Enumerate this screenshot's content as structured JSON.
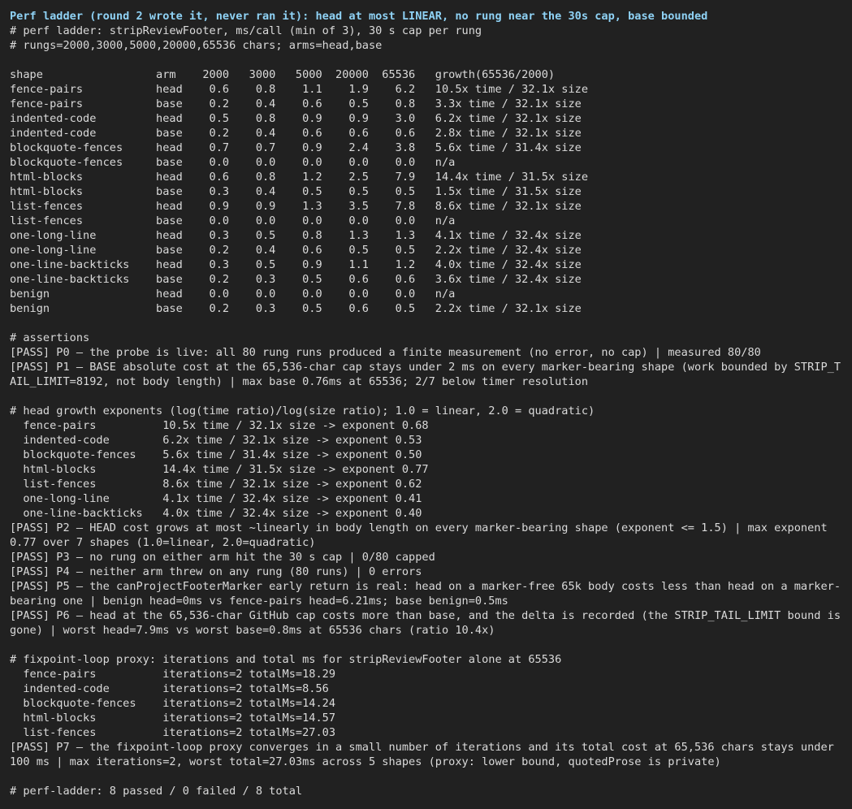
{
  "terminal": {
    "title": "Perf ladder (round 2 wrote it, never ran it): head at most LINEAR, no rung near the 30s cap, base bounded",
    "header": [
      "# perf ladder: stripReviewFooter, ms/call (min of 3), 30 s cap per rung",
      "# rungs=2000,3000,5000,20000,65536 chars; arms=head,base"
    ],
    "table_header": "shape                 arm    2000   3000   5000  20000  65536   growth(65536/2000)",
    "table_rows": [
      "fence-pairs           head    0.6    0.8    1.1    1.9    6.2   10.5x time / 32.1x size",
      "fence-pairs           base    0.2    0.4    0.6    0.5    0.8   3.3x time / 32.1x size",
      "indented-code         head    0.5    0.8    0.9    0.9    3.0   6.2x time / 32.1x size",
      "indented-code         base    0.2    0.4    0.6    0.6    0.6   2.8x time / 32.1x size",
      "blockquote-fences     head    0.7    0.7    0.9    2.4    3.8   5.6x time / 31.4x size",
      "blockquote-fences     base    0.0    0.0    0.0    0.0    0.0   n/a",
      "html-blocks           head    0.6    0.8    1.2    2.5    7.9   14.4x time / 31.5x size",
      "html-blocks           base    0.3    0.4    0.5    0.5    0.5   1.5x time / 31.5x size",
      "list-fences           head    0.9    0.9    1.3    3.5    7.8   8.6x time / 32.1x size",
      "list-fences           base    0.0    0.0    0.0    0.0    0.0   n/a",
      "one-long-line         head    0.3    0.5    0.8    1.3    1.3   4.1x time / 32.4x size",
      "one-long-line         base    0.2    0.4    0.6    0.5    0.5   2.2x time / 32.4x size",
      "one-line-backticks    head    0.3    0.5    0.9    1.1    1.2   4.0x time / 32.4x size",
      "one-line-backticks    base    0.2    0.3    0.5    0.6    0.6   3.6x time / 32.4x size",
      "benign                head    0.0    0.0    0.0    0.0    0.0   n/a",
      "benign                base    0.2    0.3    0.5    0.6    0.5   2.2x time / 32.1x size"
    ],
    "assertions_header": "# assertions",
    "p0": "[PASS] P0 — the probe is live: all 80 rung runs produced a finite measurement (no error, no cap) | measured 80/80",
    "p1": "[PASS] P1 — BASE absolute cost at the 65,536-char cap stays under 2 ms on every marker-bearing shape (work bounded by STRIP_TAIL_LIMIT=8192, not body length) | max base 0.76ms at 65536; 2/7 below timer resolution",
    "growth_header": "# head growth exponents (log(time ratio)/log(size ratio); 1.0 = linear, 2.0 = quadratic)",
    "growth_rows": [
      "  fence-pairs          10.5x time / 32.1x size -> exponent 0.68",
      "  indented-code        6.2x time / 32.1x size -> exponent 0.53",
      "  blockquote-fences    5.6x time / 31.4x size -> exponent 0.50",
      "  html-blocks          14.4x time / 31.5x size -> exponent 0.77",
      "  list-fences          8.6x time / 32.1x size -> exponent 0.62",
      "  one-long-line        4.1x time / 32.4x size -> exponent 0.41",
      "  one-line-backticks   4.0x time / 32.4x size -> exponent 0.40"
    ],
    "p2": "[PASS] P2 — HEAD cost grows at most ~linearly in body length on every marker-bearing shape (exponent <= 1.5) | max exponent 0.77 over 7 shapes (1.0=linear, 2.0=quadratic)",
    "p3": "[PASS] P3 — no rung on either arm hit the 30 s cap | 0/80 capped",
    "p4": "[PASS] P4 — neither arm threw on any rung (80 runs) | 0 errors",
    "p5": "[PASS] P5 — the canProjectFooterMarker early return is real: head on a marker-free 65k body costs less than head on a marker-bearing one | benign head=0ms vs fence-pairs head=6.21ms; base benign=0.5ms",
    "p6": "[PASS] P6 — head at the 65,536-char GitHub cap costs more than base, and the delta is recorded (the STRIP_TAIL_LIMIT bound is gone) | worst head=7.9ms vs worst base=0.8ms at 65536 chars (ratio 10.4x)",
    "fixpoint_header": "# fixpoint-loop proxy: iterations and total ms for stripReviewFooter alone at 65536",
    "fixpoint_rows": [
      "  fence-pairs          iterations=2 totalMs=18.29",
      "  indented-code        iterations=2 totalMs=8.56",
      "  blockquote-fences    iterations=2 totalMs=14.24",
      "  html-blocks          iterations=2 totalMs=14.57",
      "  list-fences          iterations=2 totalMs=27.03"
    ],
    "p7": "[PASS] P7 — the fixpoint-loop proxy converges in a small number of iterations and its total cost at 65,536 chars stays under 100 ms | max iterations=2, worst total=27.03ms across 5 shapes (proxy: lower bound, quotedProse is private)",
    "summary": "# perf-ladder: 8 passed / 0 failed / 8 total"
  }
}
